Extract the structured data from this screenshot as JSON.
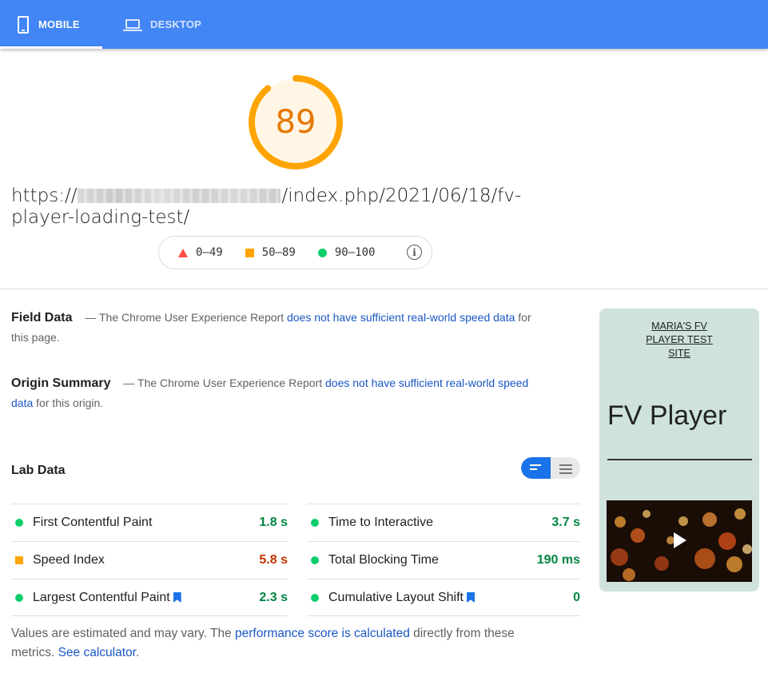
{
  "tabs": {
    "mobile_label": "MOBILE",
    "desktop_label": "DESKTOP",
    "active": "mobile"
  },
  "score": {
    "value": 89,
    "gauge_fraction": 0.89,
    "color": "#ffa400"
  },
  "url": {
    "prefix": "https://",
    "suffix": "/index.php/2021/06/18/fv-player-loading-test/"
  },
  "legend": {
    "fail_range": "0–49",
    "average_range": "50–89",
    "pass_range": "90–100"
  },
  "field_data": {
    "title": "Field Data",
    "dash": "—",
    "text_before": "The Chrome User Experience Report",
    "link": "does not have sufficient real-world speed data",
    "text_after": "for this page."
  },
  "origin_summary": {
    "title": "Origin Summary",
    "dash": "—",
    "text_before": "The Chrome User Experience Report",
    "link": "does not have sufficient real-world speed data",
    "text_after": "for this origin."
  },
  "lab_data": {
    "title": "Lab Data",
    "metrics_left": [
      {
        "label": "First Contentful Paint",
        "value": "1.8 s",
        "status": "pass",
        "bookmark": false
      },
      {
        "label": "Speed Index",
        "value": "5.8 s",
        "status": "fail",
        "bookmark": false
      },
      {
        "label": "Largest Contentful Paint",
        "value": "2.3 s",
        "status": "pass",
        "bookmark": true
      }
    ],
    "metrics_right": [
      {
        "label": "Time to Interactive",
        "value": "3.7 s",
        "status": "pass",
        "bookmark": false
      },
      {
        "label": "Total Blocking Time",
        "value": "190 ms",
        "status": "pass",
        "bookmark": false
      },
      {
        "label": "Cumulative Layout Shift",
        "value": "0",
        "status": "pass",
        "bookmark": true
      }
    ]
  },
  "footnote": {
    "text1": "Values are estimated and may vary. The",
    "link1": "performance score is calculated",
    "text2": "directly from these metrics.",
    "link2": "See calculator",
    "text3": "."
  },
  "preview": {
    "site_title_lines": [
      "MARIA'S FV",
      "PLAYER TEST",
      "SITE"
    ],
    "page_heading": "FV Player"
  },
  "colors": {
    "brand_blue": "#4285f4",
    "pass_green": "#0cce6b",
    "average_orange": "#ffa400",
    "fail_red": "#ff4e42",
    "link_blue": "#1a57c4"
  }
}
